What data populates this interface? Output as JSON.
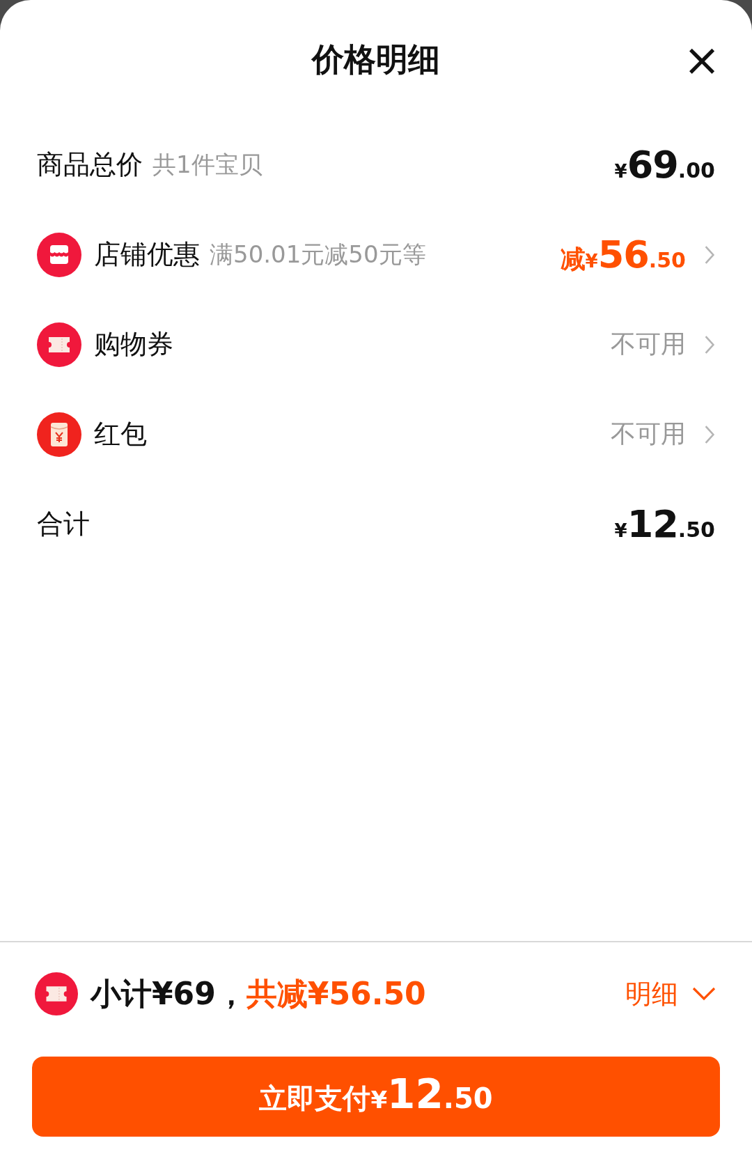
{
  "sheet": {
    "title": "价格明细",
    "close_label": "×"
  },
  "rows": [
    {
      "kind": "plain",
      "label": "商品总价",
      "note": "共1件宝贝",
      "price": {
        "currency": "¥",
        "integer": "69",
        "decimal": ".00"
      },
      "highlight": false
    },
    {
      "kind": "store",
      "label": "店铺优惠",
      "note": "满50.01元减50元等",
      "price": {
        "prefix": "减",
        "currency": "¥",
        "integer": "56",
        "decimal": ".50"
      },
      "highlight": true
    },
    {
      "kind": "ticket",
      "label": "购物券",
      "status": "不可用"
    },
    {
      "kind": "envelope",
      "label": "红包",
      "status": "不可用"
    },
    {
      "kind": "plain",
      "label": "合计",
      "price": {
        "currency": "¥",
        "integer": "12",
        "decimal": ".50"
      },
      "highlight": false
    }
  ],
  "footer": {
    "subtotal": "小计¥69，",
    "saved": "共减¥56.50",
    "details_label": "明细",
    "expanded": false,
    "pay_button": {
      "label": "立即支付",
      "currency": "¥",
      "integer": "12",
      "decimal": ".50"
    }
  }
}
